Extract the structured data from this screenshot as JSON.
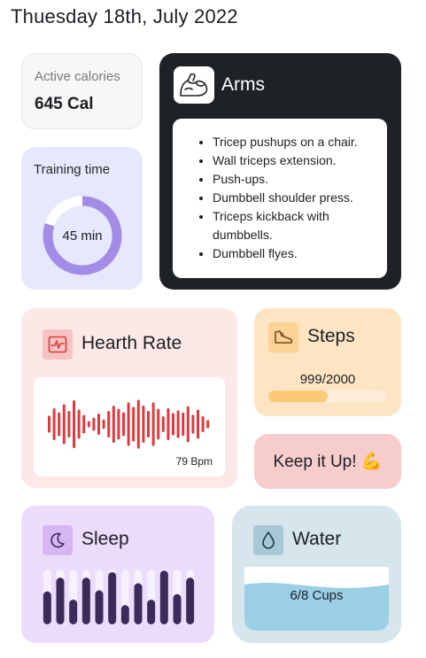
{
  "header": {
    "date": "Thuesday 18th, July 2022"
  },
  "calories": {
    "label": "Active calories",
    "value": "645 Cal"
  },
  "training": {
    "label": "Training time",
    "value": "45 min",
    "progress": 0.8
  },
  "arms": {
    "title": "Arms",
    "icon": "flexed-arm-icon",
    "exercises": [
      "Tricep pushups on a chair.",
      "Wall triceps extension.",
      "Push-ups.",
      "Dumbbell shoulder press.",
      "Triceps kickback with dumbbells.",
      "Dumbbell flyes."
    ]
  },
  "heart": {
    "title": "Hearth Rate",
    "icon": "heart-pulse-icon",
    "bpm": "79 Bpm",
    "wave": [
      0.32,
      0.6,
      0.45,
      0.75,
      0.5,
      0.9,
      0.55,
      0.35,
      0.12,
      0.25,
      0.4,
      0.18,
      0.5,
      0.7,
      0.58,
      0.45,
      0.82,
      0.65,
      0.92,
      0.7,
      0.5,
      0.82,
      0.58,
      0.3,
      0.6,
      0.42,
      0.52,
      0.44,
      0.68,
      0.36,
      0.55,
      0.3,
      0.16
    ],
    "color": "#e0393d"
  },
  "steps": {
    "title": "Steps",
    "icon": "sneaker-icon",
    "count": "999/2000",
    "progress": 0.5
  },
  "motivation": {
    "text": "Keep it Up! 💪"
  },
  "sleep": {
    "title": "Sleep",
    "icon": "moon-icon",
    "bars": [
      0.6,
      0.85,
      0.45,
      0.85,
      0.62,
      0.95,
      0.35,
      0.75,
      0.45,
      0.98,
      0.55,
      0.85
    ]
  },
  "water": {
    "title": "Water",
    "icon": "water-drop-icon",
    "value": "6/8 Cups",
    "fill": 0.75
  }
}
